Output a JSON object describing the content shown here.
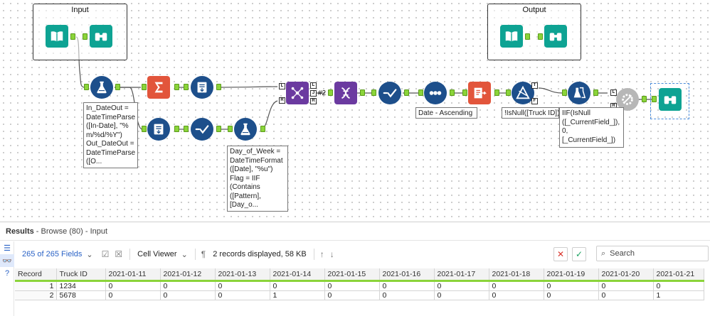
{
  "canvas": {
    "containers": [
      {
        "title": "Input"
      },
      {
        "title": "Output"
      }
    ],
    "annotations": {
      "formula1": "In_DateOut =\nDateTimeParse\n([In-Date], \"%\nm/%d/%Y\")\nOut_DateOut =\nDateTimeParse\n([O...",
      "formula2": "Day_of_Week =\nDateTimeFormat\n([Date], \"%u\")\nFlag = IIF\n(Contains\n([Pattern],\n[Day_o...",
      "sort": "Date - Ascending",
      "filter": "!IsNull([Truck ID])",
      "multifield": "IIF(IsNull\n([_CurrentField_]),\n0,\n[_CurrentField_])"
    },
    "connection_label": "#2",
    "anchor_labels": {
      "L": "L",
      "J": "J",
      "R": "R",
      "T": "T",
      "F": "F"
    }
  },
  "results": {
    "title_bold": "Results",
    "title_rest": " - Browse (80) - Input",
    "toolbar": {
      "fields": "265 of 265 Fields",
      "cell_viewer": "Cell Viewer",
      "records_info": "2 records displayed, 58 KB",
      "search_placeholder": "Search"
    },
    "columns": [
      "Record",
      "Truck ID",
      "2021-01-11",
      "2021-01-12",
      "2021-01-13",
      "2021-01-14",
      "2021-01-15",
      "2021-01-16",
      "2021-01-17",
      "2021-01-18",
      "2021-01-19",
      "2021-01-20",
      "2021-01-21"
    ],
    "rows": [
      [
        "1",
        "1234",
        "0",
        "0",
        "0",
        "0",
        "0",
        "0",
        "0",
        "0",
        "0",
        "0",
        "0"
      ],
      [
        "2",
        "5678",
        "0",
        "0",
        "0",
        "1",
        "0",
        "0",
        "0",
        "0",
        "0",
        "0",
        "1"
      ]
    ]
  },
  "icons": [
    "input-book-icon",
    "browse-binoculars-icon",
    "formula-flask-icon",
    "summarize-sigma-icon",
    "join-icon",
    "select-icon",
    "sort-icon",
    "filter-icon",
    "multifield-icon",
    "cleanse-icon",
    "transpose-icon"
  ],
  "colors": {
    "teal": "#0ea393",
    "navy": "#1d4f8b",
    "orange": "#e2553b",
    "purple": "#6b3aa0",
    "anchor_green": "#8bd43a",
    "link_blue": "#2b63c6"
  }
}
